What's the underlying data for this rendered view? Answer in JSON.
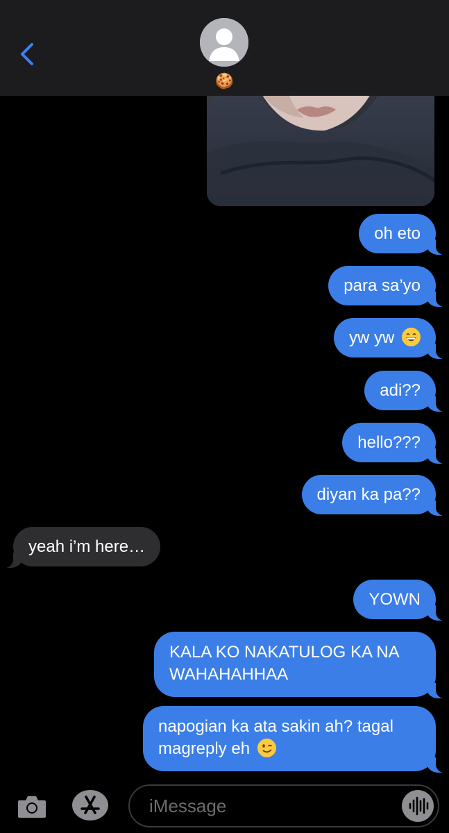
{
  "header": {
    "contact_name": "🍪"
  },
  "messages": [
    {
      "id": "m1",
      "side": "sent",
      "text": "oh eto"
    },
    {
      "id": "m2",
      "side": "sent",
      "text": "para sa’yo"
    },
    {
      "id": "m3",
      "side": "sent",
      "text": "yw yw",
      "emoji": "grinning-face-emoji"
    },
    {
      "id": "m4",
      "side": "sent",
      "text": "adi??"
    },
    {
      "id": "m5",
      "side": "sent",
      "text": "hello???"
    },
    {
      "id": "m6",
      "side": "sent",
      "text": "diyan ka pa??"
    },
    {
      "id": "m7",
      "side": "received",
      "text": "yeah i’m here…"
    },
    {
      "id": "m8",
      "side": "sent",
      "text": "YOWN"
    },
    {
      "id": "m9",
      "side": "sent",
      "text": "KALA KO NAKATULOG KA NA WAHAHAHHAA"
    },
    {
      "id": "m10",
      "side": "sent",
      "text": "napogian ka ata sakin ah? tagal magreply eh",
      "emoji": "winking-face-emoji"
    }
  ],
  "input": {
    "placeholder": "iMessage"
  },
  "colors": {
    "sent_bubble": "#3b7ee8",
    "received_bubble": "#2e2e30",
    "background": "#000000",
    "header": "#1c1c1e"
  }
}
